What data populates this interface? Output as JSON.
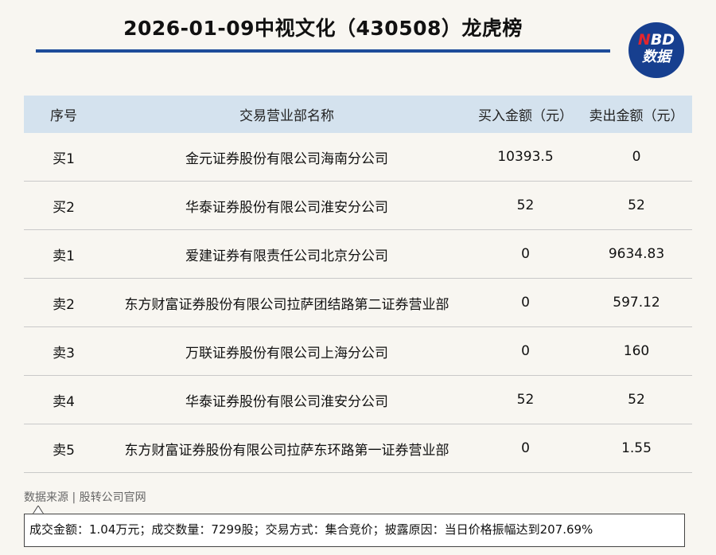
{
  "title": "2026-01-09中视文化（430508）龙虎榜",
  "logo": {
    "n": "N",
    "bd": "BD",
    "line2": "数据"
  },
  "table": {
    "headers": [
      "序号",
      "交易营业部名称",
      "买入金额（元）",
      "卖出金额（元）"
    ],
    "rows": [
      [
        "买1",
        "金元证券股份有限公司海南分公司",
        "10393.5",
        "0"
      ],
      [
        "买2",
        "华泰证券股份有限公司淮安分公司",
        "52",
        "52"
      ],
      [
        "卖1",
        "爱建证券有限责任公司北京分公司",
        "0",
        "9634.83"
      ],
      [
        "卖2",
        "东方财富证券股份有限公司拉萨团结路第二证券营业部",
        "0",
        "597.12"
      ],
      [
        "卖3",
        "万联证券股份有限公司上海分公司",
        "0",
        "160"
      ],
      [
        "卖4",
        "华泰证券股份有限公司淮安分公司",
        "52",
        "52"
      ],
      [
        "卖5",
        "东方财富证券股份有限公司拉萨东环路第一证券营业部",
        "0",
        "1.55"
      ]
    ]
  },
  "source": "数据来源 | 股转公司官网",
  "note": "成交金额：1.04万元；成交数量：7299股；交易方式：集合竞价；披露原因：当日价格振幅达到207.69%",
  "colors": {
    "accent": "#1e4c9a",
    "header_bg": "#d4e2ee",
    "logo_bg": "#173f8f",
    "logo_red": "#e3262e",
    "page_bg": "#f8f6f1"
  }
}
